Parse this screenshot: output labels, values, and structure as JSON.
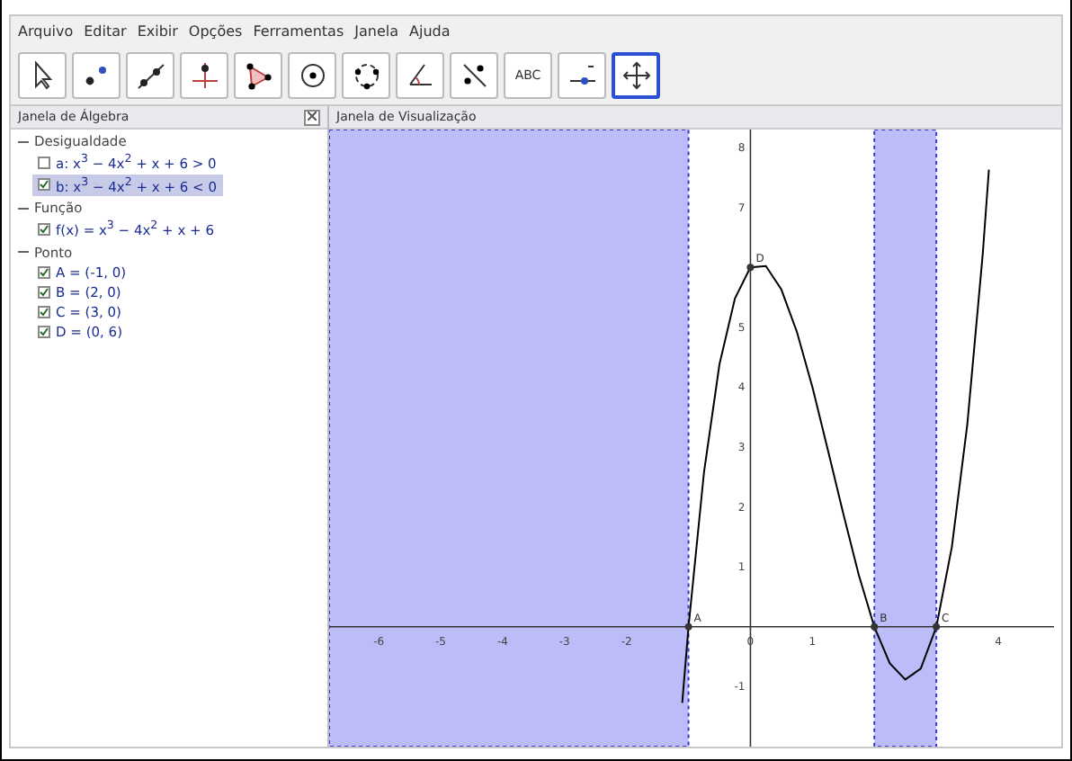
{
  "menu": [
    "Arquivo",
    "Editar",
    "Exibir",
    "Opções",
    "Ferramentas",
    "Janela",
    "Ajuda"
  ],
  "toolbar": [
    {
      "kind": "pointer",
      "selected": false
    },
    {
      "kind": "point",
      "selected": false
    },
    {
      "kind": "line",
      "selected": false
    },
    {
      "kind": "perpendicular",
      "selected": false
    },
    {
      "kind": "polygon",
      "selected": false
    },
    {
      "kind": "circle",
      "selected": false
    },
    {
      "kind": "circle3",
      "selected": false
    },
    {
      "kind": "angle",
      "selected": false
    },
    {
      "kind": "reflect",
      "selected": false
    },
    {
      "kind": "text",
      "label": "ABC",
      "selected": false
    },
    {
      "kind": "slider",
      "selected": false
    },
    {
      "kind": "move",
      "selected": true
    }
  ],
  "algebra": {
    "title": "Janela de Álgebra",
    "groups": [
      {
        "label": "Desigualdade",
        "expanded": true,
        "items": [
          {
            "text": "a: x$^{3}$ − 4x$^{2}$ + x + 6 > 0",
            "checked": false,
            "selected": false
          },
          {
            "text": "b: x$^{3}$ − 4x$^{2}$ + x + 6 < 0",
            "checked": true,
            "selected": true
          }
        ]
      },
      {
        "label": "Função",
        "expanded": true,
        "items": [
          {
            "text": "f(x) = x$^{3}$ − 4x$^{2}$ + x + 6",
            "checked": true,
            "selected": false
          }
        ]
      },
      {
        "label": "Ponto",
        "expanded": true,
        "items": [
          {
            "text": "A = (-1, 0)",
            "checked": true,
            "selected": false
          },
          {
            "text": "B = (2, 0)",
            "checked": true,
            "selected": false
          },
          {
            "text": "C = (3, 0)",
            "checked": true,
            "selected": false
          },
          {
            "text": "D = (0, 6)",
            "checked": true,
            "selected": false
          }
        ]
      }
    ]
  },
  "graphics": {
    "title": "Janela de Visualização",
    "chart_data": {
      "type": "line",
      "x": [
        -1.1,
        -1,
        -0.75,
        -0.5,
        -0.25,
        0,
        0.25,
        0.5,
        0.75,
        1,
        1.25,
        1.5,
        1.75,
        2,
        2.25,
        2.5,
        2.75,
        3,
        3.25,
        3.5,
        3.75,
        3.85
      ],
      "series": [
        {
          "color": "#000000",
          "values": [
            -1.27,
            0,
            2.58,
            4.38,
            5.48,
            6,
            6.02,
            5.63,
            4.92,
            4,
            2.95,
            1.88,
            0.86,
            0,
            -0.61,
            -0.88,
            -0.7,
            0,
            1.33,
            3.38,
            6.23,
            7.63
          ]
        }
      ],
      "xlim": [
        -6.8,
        4.9
      ],
      "ylim": [
        -2,
        8.3
      ],
      "xticks": [
        {
          "value": -6,
          "label": "-6"
        },
        {
          "value": -5,
          "label": "-5"
        },
        {
          "value": -4,
          "label": "-4"
        },
        {
          "value": -3,
          "label": "-3"
        },
        {
          "value": -2,
          "label": "-2"
        },
        {
          "value": 0,
          "label": "0"
        },
        {
          "value": 1,
          "label": "1"
        },
        {
          "value": 4,
          "label": "4"
        }
      ],
      "yticks": [
        {
          "value": -1,
          "label": "-1"
        },
        {
          "value": 1,
          "label": "1"
        },
        {
          "value": 2,
          "label": "2"
        },
        {
          "value": 3,
          "label": "3"
        },
        {
          "value": 4,
          "label": "4"
        },
        {
          "value": 5,
          "label": "5"
        },
        {
          "value": 7,
          "label": "7"
        },
        {
          "value": 8,
          "label": "8"
        }
      ],
      "annotations": [
        {
          "x": -1,
          "y": 0,
          "text": "A"
        },
        {
          "x": 2,
          "y": 0,
          "text": "B"
        },
        {
          "x": 3,
          "y": 0,
          "text": "C"
        },
        {
          "x": 0,
          "y": 6,
          "text": "D"
        }
      ]
    }
  }
}
